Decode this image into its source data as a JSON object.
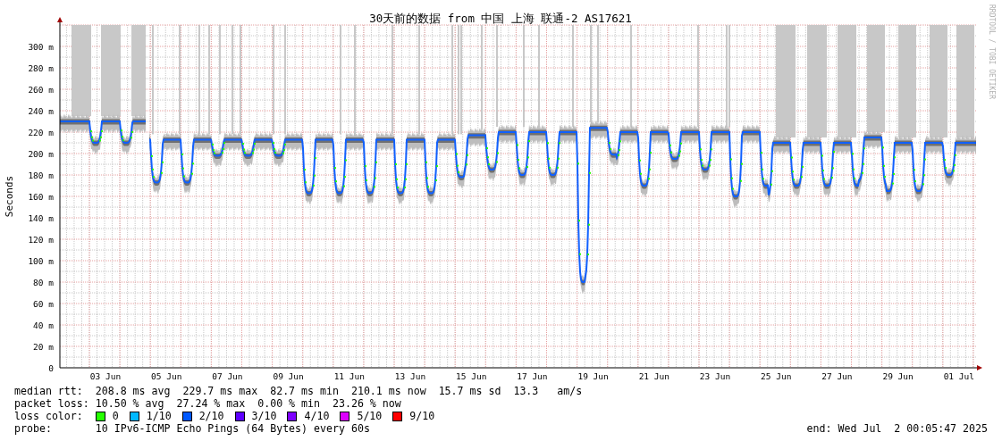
{
  "title": "30天前的数据 from 中国 上海 联通-2 AS17621",
  "credit": "RRDTOOL / TOBI OETIKER",
  "y_axis": {
    "label": "Seconds",
    "ticks": [
      "300 m",
      "280 m",
      "260 m",
      "240 m",
      "220 m",
      "200 m",
      "180 m",
      "160 m",
      "140 m",
      "120 m",
      "100 m",
      "80 m",
      "60 m",
      "40 m",
      "20 m",
      "0"
    ]
  },
  "x_axis": {
    "ticks": [
      "03 Jun",
      "05 Jun",
      "07 Jun",
      "09 Jun",
      "11 Jun",
      "13 Jun",
      "15 Jun",
      "17 Jun",
      "19 Jun",
      "21 Jun",
      "23 Jun",
      "25 Jun",
      "27 Jun",
      "29 Jun",
      "01 Jul"
    ]
  },
  "legend": {
    "rows": [
      {
        "label": "median rtt:",
        "text": "208.8 ms avg  229.7 ms max  82.7 ms min  210.1 ms now  15.7 ms sd  13.3   am/s"
      },
      {
        "label": "packet loss:",
        "text": "10.50 % avg  27.24 % max  0.00 % min  23.26 % now"
      }
    ],
    "loss_colors": {
      "label": "loss color:",
      "items": [
        {
          "label": "0",
          "color": "#26ff00"
        },
        {
          "label": "1/10",
          "color": "#00b8ff"
        },
        {
          "label": "2/10",
          "color": "#0059ff"
        },
        {
          "label": "3/10",
          "color": "#5e00ff"
        },
        {
          "label": "4/10",
          "color": "#7e00ff"
        },
        {
          "label": "5/10",
          "color": "#dd00ff"
        },
        {
          "label": "9/10",
          "color": "#ff0000"
        }
      ]
    },
    "probe": {
      "label": "probe:",
      "text": "10 IPv6-ICMP Echo Pings (64 Bytes) every 60s"
    },
    "end": "end: Wed Jul  2 00:05:47 2025"
  }
}
